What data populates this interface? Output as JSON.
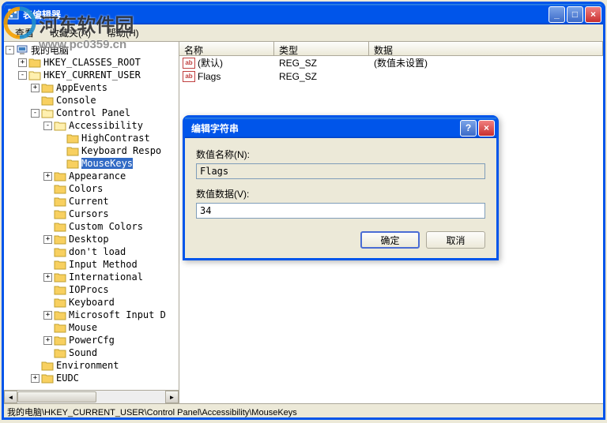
{
  "main_window": {
    "title": "表编辑器",
    "minimize": "_",
    "maximize": "□",
    "close": "×"
  },
  "menubar": {
    "search": "查看",
    "favorites": "收藏夹(A)",
    "help": "帮助(H)"
  },
  "tree": {
    "root": "我的电脑",
    "items": [
      {
        "indent": 1,
        "exp": "+",
        "label": "HKEY_CLASSES_ROOT"
      },
      {
        "indent": 1,
        "exp": "-",
        "label": "HKEY_CURRENT_USER"
      },
      {
        "indent": 2,
        "exp": "+",
        "label": "AppEvents"
      },
      {
        "indent": 2,
        "exp": " ",
        "label": "Console"
      },
      {
        "indent": 2,
        "exp": "-",
        "label": "Control Panel"
      },
      {
        "indent": 3,
        "exp": "-",
        "label": "Accessibility"
      },
      {
        "indent": 4,
        "exp": " ",
        "label": "HighContrast"
      },
      {
        "indent": 4,
        "exp": " ",
        "label": "Keyboard Respo"
      },
      {
        "indent": 4,
        "exp": " ",
        "label": "MouseKeys",
        "selected": true
      },
      {
        "indent": 3,
        "exp": "+",
        "label": "Appearance"
      },
      {
        "indent": 3,
        "exp": " ",
        "label": "Colors"
      },
      {
        "indent": 3,
        "exp": " ",
        "label": "Current"
      },
      {
        "indent": 3,
        "exp": " ",
        "label": "Cursors"
      },
      {
        "indent": 3,
        "exp": " ",
        "label": "Custom Colors"
      },
      {
        "indent": 3,
        "exp": "+",
        "label": "Desktop"
      },
      {
        "indent": 3,
        "exp": " ",
        "label": "don't load"
      },
      {
        "indent": 3,
        "exp": " ",
        "label": "Input Method"
      },
      {
        "indent": 3,
        "exp": "+",
        "label": "International"
      },
      {
        "indent": 3,
        "exp": " ",
        "label": "IOProcs"
      },
      {
        "indent": 3,
        "exp": " ",
        "label": "Keyboard"
      },
      {
        "indent": 3,
        "exp": "+",
        "label": "Microsoft Input D"
      },
      {
        "indent": 3,
        "exp": " ",
        "label": "Mouse"
      },
      {
        "indent": 3,
        "exp": "+",
        "label": "PowerCfg"
      },
      {
        "indent": 3,
        "exp": " ",
        "label": "Sound"
      },
      {
        "indent": 2,
        "exp": " ",
        "label": "Environment"
      },
      {
        "indent": 2,
        "exp": "+",
        "label": "EUDC"
      }
    ]
  },
  "list": {
    "columns": {
      "name": "名称",
      "type": "类型",
      "data": "数据"
    },
    "rows": [
      {
        "name": "(默认)",
        "type": "REG_SZ",
        "data": "(数值未设置)"
      },
      {
        "name": "Flags",
        "type": "REG_SZ",
        "data": ""
      }
    ]
  },
  "statusbar": "我的电脑\\HKEY_CURRENT_USER\\Control Panel\\Accessibility\\MouseKeys",
  "dialog": {
    "title": "编辑字符串",
    "name_label": "数值名称(N):",
    "name_value": "Flags",
    "data_label": "数值数据(V):",
    "data_value": "34",
    "ok": "确定",
    "cancel": "取消",
    "help": "?",
    "close": "×"
  },
  "watermark": {
    "brand": "河东软件园",
    "url": "www.pc0359.cn"
  },
  "icons": {
    "string": "ab"
  }
}
